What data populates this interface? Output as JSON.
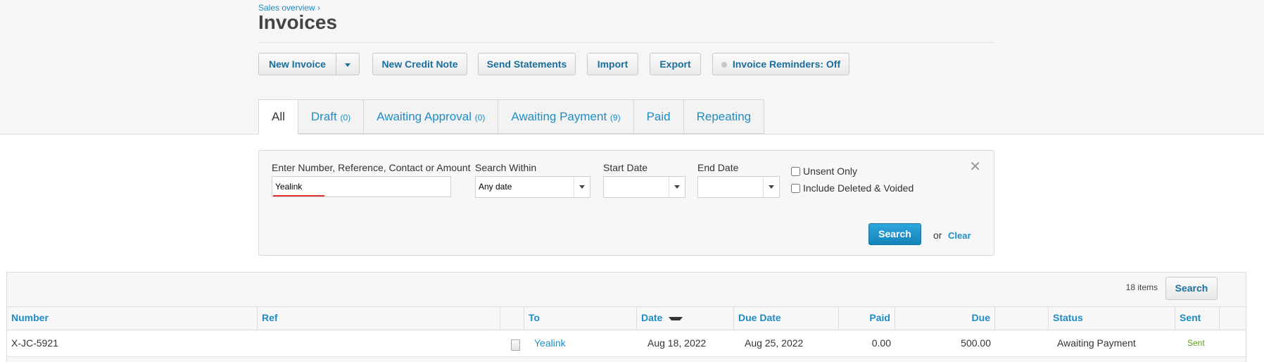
{
  "header": {
    "breadcrumb": "Sales overview ›",
    "title": "Invoices"
  },
  "toolbar": {
    "new_invoice": "New Invoice",
    "new_credit_note": "New Credit Note",
    "send_statements": "Send Statements",
    "import": "Import",
    "export": "Export",
    "invoice_reminders": "Invoice Reminders: Off"
  },
  "tabs": [
    {
      "label": "All",
      "count": ""
    },
    {
      "label": "Draft",
      "count": "(0)"
    },
    {
      "label": "Awaiting Approval",
      "count": "(0)"
    },
    {
      "label": "Awaiting Payment",
      "count": "(9)"
    },
    {
      "label": "Paid",
      "count": ""
    },
    {
      "label": "Repeating",
      "count": ""
    }
  ],
  "search": {
    "query_label": "Enter Number, Reference, Contact or Amount",
    "query_value": "Yealink",
    "within_label": "Search Within",
    "within_value": "Any date",
    "start_label": "Start Date",
    "start_value": "",
    "end_label": "End Date",
    "end_value": "",
    "unsent_only": "Unsent Only",
    "include_deleted": "Include Deleted & Voided",
    "search_button": "Search",
    "or_text": "or",
    "clear_link": "Clear",
    "close_glyph": "✕"
  },
  "table": {
    "items_count": "18 items",
    "search_button": "Search",
    "columns": {
      "number": "Number",
      "ref": "Ref",
      "to": "To",
      "date": "Date",
      "due_date": "Due Date",
      "paid": "Paid",
      "due": "Due",
      "status": "Status",
      "sent": "Sent"
    },
    "rows": [
      {
        "number": "X-JC-5921",
        "ref": "",
        "to": "Yealink",
        "date": "Aug 18, 2022",
        "due_date": "Aug 25, 2022",
        "paid": "0.00",
        "due": "500.00",
        "status": "Awaiting Payment",
        "sent": "Sent"
      }
    ]
  },
  "colors": {
    "link": "#1f8dc5",
    "primary_button": "#1f8dc5",
    "sent_status": "#5a9e1f",
    "spellcheck": "#e03030"
  }
}
